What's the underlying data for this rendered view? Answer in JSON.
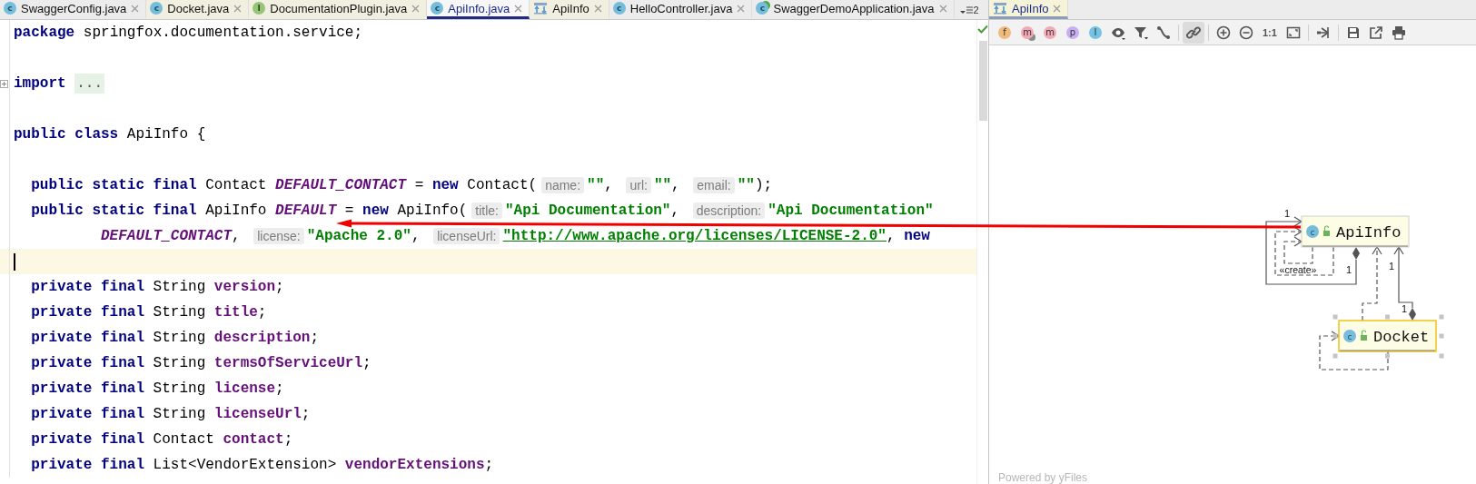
{
  "editor_tabs": [
    {
      "label": "SwaggerConfig.java",
      "icon": {
        "kind": "class",
        "letter": "c"
      },
      "selected": false,
      "color": "#ececec"
    },
    {
      "label": "Docket.java",
      "icon": {
        "kind": "class",
        "letter": "c"
      },
      "selected": false,
      "color": "#f1f0e0"
    },
    {
      "label": "DocumentationPlugin.java",
      "icon": {
        "kind": "interface",
        "letter": "I"
      },
      "selected": false,
      "color": "#f1f0e0"
    },
    {
      "label": "ApiInfo.java",
      "icon": {
        "kind": "class",
        "letter": "c"
      },
      "selected": true,
      "color": "#f7f7f7"
    },
    {
      "label": "ApiInfo",
      "icon": {
        "kind": "diagram"
      },
      "selected": false,
      "color": "#f1f0e0"
    },
    {
      "label": "HelloController.java",
      "icon": {
        "kind": "class",
        "letter": "c"
      },
      "selected": false,
      "color": "#ececec"
    },
    {
      "label": "SwaggerDemoApplication.java",
      "icon": {
        "kind": "app",
        "letter": "c"
      },
      "selected": false,
      "color": "#ececec"
    }
  ],
  "tab_overflow": "2",
  "code_lines": [
    {
      "kind": "code",
      "current": false,
      "tokens": [
        {
          "kind": "keyword",
          "text": "package"
        },
        {
          "kind": "plain",
          "text": " springfox.documentation.service;"
        }
      ]
    },
    {
      "kind": "code",
      "current": false
    },
    {
      "kind": "folded",
      "current": false,
      "tokens": [
        {
          "kind": "keyword",
          "text": "import"
        },
        {
          "kind": "fold",
          "text": "..."
        }
      ]
    },
    {
      "kind": "code",
      "current": false
    },
    {
      "kind": "code",
      "current": false,
      "tokens": [
        {
          "kind": "keyword",
          "text": "public class"
        },
        {
          "kind": "plain",
          "text": " ApiInfo {"
        }
      ]
    },
    {
      "kind": "code",
      "current": false
    },
    {
      "kind": "member",
      "current": false,
      "tokens": [
        {
          "kind": "keyword",
          "text": "public static final"
        },
        {
          "kind": "plain",
          "text": " Contact "
        },
        {
          "kind": "const",
          "text": "DEFAULT_CONTACT"
        },
        {
          "kind": "plain",
          "text": " = "
        },
        {
          "kind": "keyword",
          "text": "new"
        },
        {
          "kind": "plain",
          "text": " Contact("
        },
        {
          "kind": "hint",
          "text": "name:"
        },
        {
          "kind": "string",
          "text": "\"\""
        },
        {
          "kind": "plain",
          "text": ", "
        },
        {
          "kind": "hint",
          "text": "url:"
        },
        {
          "kind": "string",
          "text": "\"\""
        },
        {
          "kind": "plain",
          "text": ", "
        },
        {
          "kind": "hint",
          "text": "email:"
        },
        {
          "kind": "string",
          "text": "\"\""
        },
        {
          "kind": "plain",
          "text": ");"
        }
      ]
    },
    {
      "kind": "member",
      "current": false,
      "tokens": [
        {
          "kind": "keyword",
          "text": "public static final"
        },
        {
          "kind": "plain",
          "text": " ApiInfo "
        },
        {
          "kind": "const",
          "text": "DEFAULT"
        },
        {
          "kind": "plain",
          "text": " = "
        },
        {
          "kind": "keyword",
          "text": "new"
        },
        {
          "kind": "plain",
          "text": " ApiInfo("
        },
        {
          "kind": "hint",
          "text": "title:"
        },
        {
          "kind": "string",
          "text": "\"Api Documentation\""
        },
        {
          "kind": "plain",
          "text": ", "
        },
        {
          "kind": "hint",
          "text": "description:"
        },
        {
          "kind": "string",
          "text": "\"Api Documentation\""
        }
      ]
    },
    {
      "kind": "continuation",
      "current": false,
      "tokens": [
        {
          "kind": "const",
          "text": "DEFAULT_CONTACT"
        },
        {
          "kind": "plain",
          "text": ", "
        },
        {
          "kind": "hint",
          "text": "license:"
        },
        {
          "kind": "string",
          "text": "\"Apache 2.0\""
        },
        {
          "kind": "plain",
          "text": ", "
        },
        {
          "kind": "hint",
          "text": "licenseUrl:"
        },
        {
          "kind": "url",
          "text": "\"http://www.apache.org/licenses/LICENSE-2.0\""
        },
        {
          "kind": "plain",
          "text": ", "
        },
        {
          "kind": "keyword",
          "text": "new"
        }
      ]
    },
    {
      "kind": "code",
      "current": true
    },
    {
      "kind": "member",
      "current": false,
      "tokens": [
        {
          "kind": "keyword",
          "text": "private final"
        },
        {
          "kind": "plain",
          "text": " String "
        },
        {
          "kind": "field",
          "text": "version"
        },
        {
          "kind": "plain",
          "text": ";"
        }
      ]
    },
    {
      "kind": "member",
      "current": false,
      "tokens": [
        {
          "kind": "keyword",
          "text": "private final"
        },
        {
          "kind": "plain",
          "text": " String "
        },
        {
          "kind": "field",
          "text": "title"
        },
        {
          "kind": "plain",
          "text": ";"
        }
      ]
    },
    {
      "kind": "member",
      "current": false,
      "tokens": [
        {
          "kind": "keyword",
          "text": "private final"
        },
        {
          "kind": "plain",
          "text": " String "
        },
        {
          "kind": "field",
          "text": "description"
        },
        {
          "kind": "plain",
          "text": ";"
        }
      ]
    },
    {
      "kind": "member",
      "current": false,
      "tokens": [
        {
          "kind": "keyword",
          "text": "private final"
        },
        {
          "kind": "plain",
          "text": " String "
        },
        {
          "kind": "field",
          "text": "termsOfServiceUrl"
        },
        {
          "kind": "plain",
          "text": ";"
        }
      ]
    },
    {
      "kind": "member",
      "current": false,
      "tokens": [
        {
          "kind": "keyword",
          "text": "private final"
        },
        {
          "kind": "plain",
          "text": " String "
        },
        {
          "kind": "field",
          "text": "license"
        },
        {
          "kind": "plain",
          "text": ";"
        }
      ]
    },
    {
      "kind": "member",
      "current": false,
      "tokens": [
        {
          "kind": "keyword",
          "text": "private final"
        },
        {
          "kind": "plain",
          "text": " String "
        },
        {
          "kind": "field",
          "text": "licenseUrl"
        },
        {
          "kind": "plain",
          "text": ";"
        }
      ]
    },
    {
      "kind": "member",
      "current": false,
      "tokens": [
        {
          "kind": "keyword",
          "text": "private final"
        },
        {
          "kind": "plain",
          "text": " Contact "
        },
        {
          "kind": "field",
          "text": "contact"
        },
        {
          "kind": "plain",
          "text": ";"
        }
      ]
    },
    {
      "kind": "member",
      "current": false,
      "tokens": [
        {
          "kind": "keyword",
          "text": "private final"
        },
        {
          "kind": "plain",
          "text": " List<VendorExtension> "
        },
        {
          "kind": "field",
          "text": "vendorExtensions"
        },
        {
          "kind": "plain",
          "text": ";"
        }
      ]
    }
  ],
  "diagram_tab": {
    "label": "ApiInfo",
    "selected": true
  },
  "toolbar": [
    [
      {
        "kind": "letter",
        "label": "f",
        "color": "#f0bb7c",
        "pressed": false
      },
      {
        "kind": "letter-star",
        "label": "m",
        "color": "#f2a9b6",
        "pressed": false
      },
      {
        "kind": "letter",
        "label": "m",
        "color": "#f2a9b6",
        "pressed": false
      },
      {
        "kind": "letter",
        "label": "p",
        "color": "#c9aef2",
        "pressed": false
      },
      {
        "kind": "letter",
        "label": "I",
        "color": "#73c3e3",
        "pressed": false
      },
      {
        "kind": "eye",
        "pressed": false
      },
      {
        "kind": "filter",
        "pressed": false
      },
      {
        "kind": "route",
        "pressed": false
      }
    ],
    [
      {
        "kind": "link",
        "pressed": true
      }
    ],
    [
      {
        "kind": "zoom-in",
        "pressed": false
      },
      {
        "kind": "zoom-out",
        "pressed": false
      },
      {
        "kind": "text",
        "label": "1:1",
        "pressed": false
      },
      {
        "kind": "fit",
        "pressed": false
      }
    ],
    [
      {
        "kind": "layout",
        "pressed": false
      }
    ],
    [
      {
        "kind": "save",
        "pressed": false
      },
      {
        "kind": "export",
        "pressed": false
      },
      {
        "kind": "print",
        "pressed": false
      }
    ]
  ],
  "diagram": {
    "nodes": [
      {
        "name": "ApiInfo",
        "letter": "c",
        "selected": false
      },
      {
        "name": "Docket",
        "letter": "c",
        "selected": true
      }
    ],
    "edges": [
      {
        "kind": "composition",
        "labels": [
          "1",
          "1"
        ]
      },
      {
        "kind": "dependency",
        "labels": [
          "«create»"
        ]
      },
      {
        "kind": "dependency"
      },
      {
        "kind": "dependency"
      },
      {
        "kind": "composition",
        "labels": [
          "1",
          "1"
        ]
      },
      {
        "kind": "dependency"
      }
    ]
  },
  "footer": "Powered by yFiles"
}
